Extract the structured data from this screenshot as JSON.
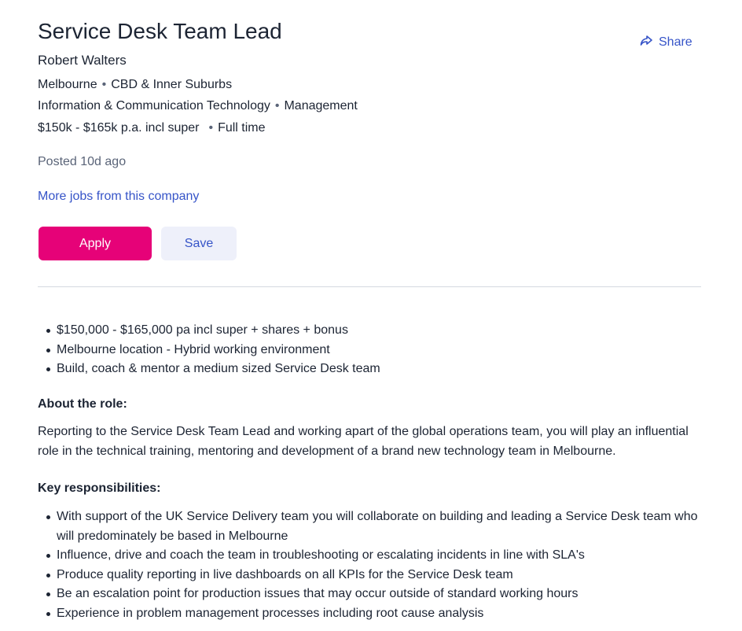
{
  "job": {
    "title": "Service Desk Team Lead",
    "company": "Robert Walters",
    "location": "Melbourne",
    "area": "CBD & Inner Suburbs",
    "classification": "Information & Communication Technology",
    "sub_classification": "Management",
    "salary": "$150k - $165k p.a. incl super",
    "work_type": "Full time",
    "posted": "Posted 10d ago",
    "more_jobs_link": "More jobs from this company"
  },
  "actions": {
    "share_label": "Share",
    "apply_label": "Apply",
    "save_label": "Save"
  },
  "colors": {
    "apply": "#e60278",
    "link": "#3654c8",
    "save_bg": "#eef0fa"
  },
  "description": {
    "highlights": [
      "$150,000 - $165,000 pa incl super + shares + bonus",
      "Melbourne location - Hybrid working environment",
      "Build, coach & mentor a medium sized Service Desk team"
    ],
    "about_heading": "About the role:",
    "about_text": "Reporting to the Service Desk Team Lead and working apart of the global operations team, you will play an influential role in the technical training, mentoring and development of a brand new technology team in Melbourne.",
    "responsibilities_heading": "Key responsibilities:",
    "responsibilities": [
      "With support of the UK Service Delivery team you will collaborate on building and leading a Service Desk team who will predominately be based in Melbourne",
      "Influence, drive and coach the team in troubleshooting or escalating incidents in line with SLA's",
      "Produce quality reporting in live dashboards on all KPIs for the Service Desk team",
      "Be an escalation point for production issues that may occur outside of standard working hours",
      "Experience in problem management processes including root cause analysis"
    ]
  }
}
